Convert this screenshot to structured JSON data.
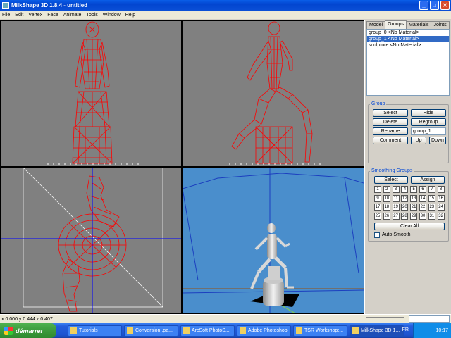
{
  "window": {
    "title": "MilkShape 3D 1.8.4 - untitled",
    "minimize_glyph": "_",
    "maximize_glyph": "□",
    "close_glyph": "✕"
  },
  "menu": [
    "File",
    "Edit",
    "Vertex",
    "Face",
    "Animate",
    "Tools",
    "Window",
    "Help"
  ],
  "viewports": {
    "wire_color": "#ff0000",
    "axis_color": "#0000ff",
    "background_ortho": "#808080",
    "background_3d": "#4a8ecc"
  },
  "panel": {
    "tabs": [
      "Model",
      "Groups",
      "Materials",
      "Joints"
    ],
    "active_tab": "Groups",
    "groups": [
      {
        "label": "group_0 <No Material>",
        "selected": false
      },
      {
        "label": "group_1 <No Material>",
        "selected": true
      },
      {
        "label": "sculpture <No Material>",
        "selected": false
      }
    ],
    "group_section": {
      "title": "Group",
      "select": "Select",
      "hide": "Hide",
      "delete": "Delete",
      "regroup": "Regroup",
      "rename": "Rename",
      "name_value": "group_1",
      "comment": "Comment",
      "up": "Up",
      "down": "Down"
    },
    "smoothing_section": {
      "title": "Smoothing Groups",
      "select": "Select",
      "assign": "Assign",
      "numbers": [
        "1",
        "2",
        "3",
        "4",
        "5",
        "6",
        "7",
        "8",
        "9",
        "10",
        "11",
        "12",
        "13",
        "14",
        "15",
        "16",
        "17",
        "18",
        "19",
        "20",
        "21",
        "22",
        "23",
        "24",
        "25",
        "26",
        "27",
        "28",
        "29",
        "30",
        "31",
        "32"
      ],
      "clear_all": "Clear All",
      "auto_smooth": "Auto Smooth"
    }
  },
  "status": {
    "coords": "x 0.000 y 0.444 z 0.407"
  },
  "taskbar": {
    "start": "démarrer",
    "tasks": [
      "Tutorials",
      "Conversion .pa...",
      "ArcSoft PhotoS...",
      "Adobe Photoshop",
      "TSR Workshop:...",
      "MilkShape 3D 1..."
    ],
    "active_task": 5,
    "language": "FR",
    "clock": "10:17"
  }
}
